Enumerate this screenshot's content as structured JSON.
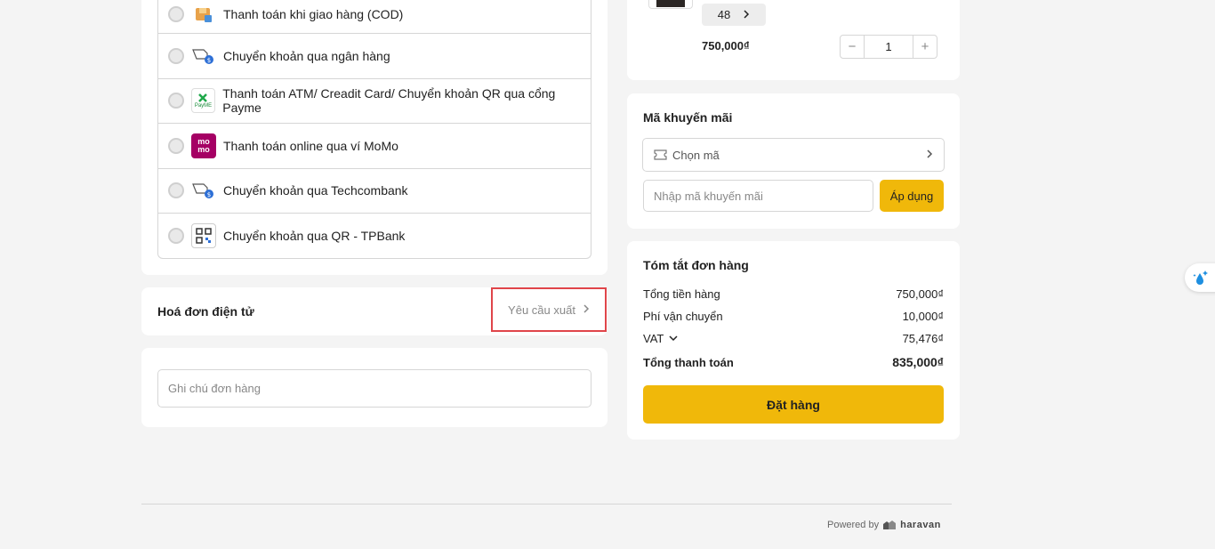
{
  "payment": {
    "methods": [
      {
        "label": "Thanh toán khi giao hàng (COD)",
        "icon": "cod-box-icon"
      },
      {
        "label": "Chuyển khoản qua ngân hàng",
        "icon": "bank-transfer-icon"
      },
      {
        "label": "Thanh toán ATM/ Creadit Card/ Chuyển khoản QR qua cổng Payme",
        "icon": "payme-icon"
      },
      {
        "label": "Thanh toán online qua ví MoMo",
        "icon": "momo-icon"
      },
      {
        "label": "Chuyển khoản qua Techcombank",
        "icon": "bank-transfer-icon"
      },
      {
        "label": "Chuyển khoản qua QR - TPBank",
        "icon": "qr-code-icon"
      }
    ],
    "payme_text": "PayME",
    "momo_text": "mo mo"
  },
  "invoice": {
    "title": "Hoá đơn điện tử",
    "request_label": "Yêu cầu xuất"
  },
  "note": {
    "placeholder": "Ghi chú đơn hàng"
  },
  "product": {
    "variant": "48",
    "price": "750,000₫",
    "quantity": "1",
    "minus": "−",
    "plus": "+"
  },
  "promo": {
    "title": "Mã khuyến mãi",
    "choose_label": "Chọn mã",
    "input_placeholder": "Nhập mã khuyến mãi",
    "apply_label": "Áp dụng"
  },
  "summary": {
    "title": "Tóm tắt đơn hàng",
    "subtotal_label": "Tổng tiền hàng",
    "subtotal_value": "750,000₫",
    "shipping_label": "Phí vận chuyển",
    "shipping_value": "10,000₫",
    "vat_label": "VAT",
    "vat_value": "75,476₫",
    "total_label": "Tổng thanh toán",
    "total_value": "835,000₫",
    "order_button": "Đặt hàng"
  },
  "footer": {
    "powered_by": "Powered by",
    "brand": "haravan"
  },
  "colors": {
    "accent": "#f0b80a",
    "highlight_border": "#e0454a",
    "momo": "#a50064"
  }
}
